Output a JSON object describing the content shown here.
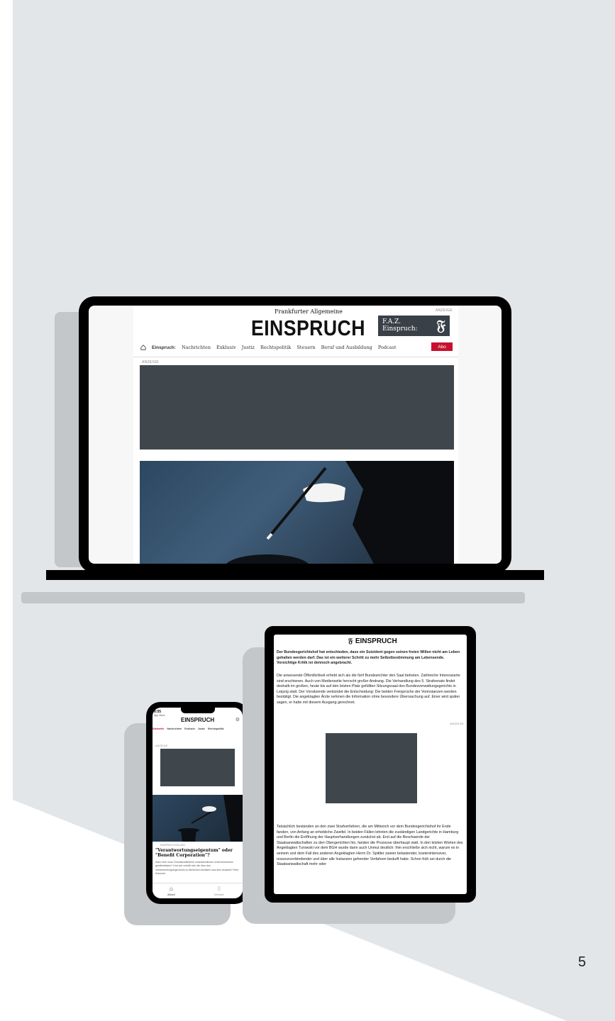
{
  "desktop": {
    "ad_label": "ANZEIGE",
    "publisher": "Frankfurter Allgemeine",
    "masthead": "EINSPRUCH",
    "banner_line1": "F.A.Z.",
    "banner_line2": "Einspruch:",
    "nav": [
      "Einspruch:",
      "Nachrichten",
      "Exklusiv",
      "Justiz",
      "Rechtspolitik",
      "Steuern",
      "Beruf und Ausbildung",
      "Podcast"
    ],
    "abo": "Abo"
  },
  "phone": {
    "time": "8:55",
    "back": "App Store",
    "masthead": "EINSPRUCH",
    "tabs": [
      "Startseite",
      "Nachrichten",
      "Exklusiv",
      "Justiz",
      "Rechtspolitik"
    ],
    "ad_label": "ANZEIGE",
    "kicker": "EINSPRUCH EXKLUSIV",
    "title": "\"Verantwortungseigentum\" oder \"Benefit Corporation\"?",
    "teaser": "Kann eine neue Gesellschaftsform verantwortliches Unternehmertum gewährleisten? Und wie verhält sich die Idee des Verantwortungseigentums zu ähnlichen Ansätzen aus dem Ausland? Eine Kolumne.",
    "bottom": [
      "Aktuell",
      "Merkliste"
    ]
  },
  "tablet": {
    "masthead": "EINSPRUCH",
    "lead": "Der Bundesgerichtshof hat entschieden, dass ein Suizident gegen seinen freien Willen nicht am Leben gehalten werden darf. Das ist ein weiterer Schritt zu mehr Selbstbestimmung am Lebensende. Vorsichtige Kritik ist dennoch angebracht.",
    "para1": "Die anwesende Öffentlichkeit erhebt sich als die fünf Bundesrichter den Saal betreten. Zahlreiche Interessierte sind erschienen. Auch von Medienseite herrscht großer Andrang. Die Verhandlung des 5. Strafsenats findet deshalb im großen, heute bis auf den letzten Platz gefüllten Sitzungssaal des Bundesverwaltungsgerichts in Leipzig statt. Der Vorsitzende verkündet die Entscheidung: Die beiden Freisprüche der Vorinstanzen werden bestätigt. Die angeklagten Ärzte nehmen die Information ohne besondere Überraschung auf. Einer wird später sagen, er habe mit diesem Ausgang gerechnet.",
    "ad_label": "ANZEIGE",
    "para2": "Tatsächlich bestanden an den zwei Strafverfahren, die am Mittwoch vor dem Bundesgerichtshof ihr Ende fanden, von Anfang an erhebliche Zweifel. In beiden Fällen lehnten die zuständigen Landgerichte in Hamburg und Berlin die Eröffnung der Hauptverhandlungen zunächst ab. Erst auf die Beschwerde der Staatsanwaltschaften zu den Obergerichten hin, fanden die Prozesse überhaupt statt. In den letzten Worten des Angeklagten Turowski vor dem BGH wurde dann auch Unmut deutlich: Ihm erschließe sich nicht, warum es in seinem und dem Fall des anderen Angeklagten Herrn Dr. Spittler zweier belastender, kostenintensiver, ressourcenbindender und über alle Instanzen gehender Verfahren bedurft habe. Schon früh sei durch die Staatsanwaltschaft mehr oder"
  },
  "page_number": "5"
}
